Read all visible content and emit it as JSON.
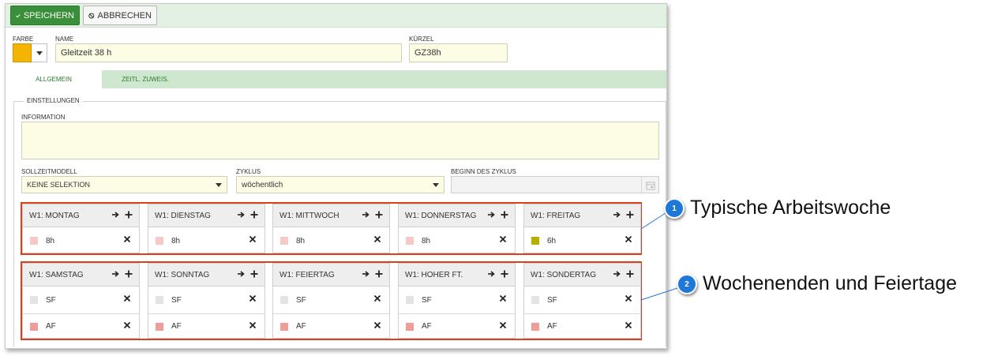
{
  "toolbar": {
    "save_label": "SPEICHERN",
    "cancel_label": "ABBRECHEN"
  },
  "form": {
    "color_label": "FARBE",
    "color_value": "#f5b400",
    "name_label": "NAME",
    "name_value": "Gleitzeit 38 h",
    "short_label": "KÜRZEL",
    "short_value": "GZ38h"
  },
  "tabs": [
    {
      "label": "ALLGEMEIN",
      "active": true
    },
    {
      "label": "ZEITL. ZUWEIS.",
      "active": false
    }
  ],
  "settings": {
    "legend": "EINSTELLUNGEN",
    "info_label": "INFORMATION",
    "info_value": "",
    "model_label": "SOLLZEITMODELL",
    "model_value": "KEINE SELEKTION",
    "cycle_label": "ZYKLUS",
    "cycle_value": "wöchentlich",
    "start_label": "BEGINN DES ZYKLUS",
    "start_value": ""
  },
  "week": [
    {
      "title": "W1: MONTAG",
      "entries": [
        {
          "label": "8h",
          "color": "#f6c9c9"
        }
      ]
    },
    {
      "title": "W1: DIENSTAG",
      "entries": [
        {
          "label": "8h",
          "color": "#f6c9c9"
        }
      ]
    },
    {
      "title": "W1: MITTWOCH",
      "entries": [
        {
          "label": "8h",
          "color": "#f6c9c9"
        }
      ]
    },
    {
      "title": "W1: DONNERSTAG",
      "entries": [
        {
          "label": "8h",
          "color": "#f6c9c9"
        }
      ]
    },
    {
      "title": "W1: FREITAG",
      "entries": [
        {
          "label": "6h",
          "color": "#b5b000"
        }
      ]
    }
  ],
  "special": [
    {
      "title": "W1: SAMSTAG",
      "entries": [
        {
          "label": "SF",
          "color": "#e3e3e3"
        },
        {
          "label": "AF",
          "color": "#f29b9b"
        }
      ]
    },
    {
      "title": "W1: SONNTAG",
      "entries": [
        {
          "label": "SF",
          "color": "#e3e3e3"
        },
        {
          "label": "AF",
          "color": "#f29b9b"
        }
      ]
    },
    {
      "title": "W1: FEIERTAG",
      "entries": [
        {
          "label": "SF",
          "color": "#e3e3e3"
        },
        {
          "label": "AF",
          "color": "#f29b9b"
        }
      ]
    },
    {
      "title": "W1: HOHER FT.",
      "entries": [
        {
          "label": "SF",
          "color": "#e3e3e3"
        },
        {
          "label": "AF",
          "color": "#f29b9b"
        }
      ]
    },
    {
      "title": "W1: SONDERTAG",
      "entries": [
        {
          "label": "SF",
          "color": "#e3e3e3"
        },
        {
          "label": "AF",
          "color": "#f29b9b"
        }
      ]
    }
  ],
  "callouts": [
    {
      "number": "1",
      "text": "Typische Arbeitswoche"
    },
    {
      "number": "2",
      "text": "Wochenenden und Feiertage"
    }
  ],
  "colors": {
    "accent_green": "#3a8f3a",
    "highlight_red": "#d9401c",
    "callout_blue": "#1e78d8"
  },
  "icons": {
    "save": "check-icon",
    "cancel": "ban-icon",
    "copy": "arrow-right-icon",
    "add": "plus-icon",
    "remove": "close-icon",
    "calendar": "calendar-icon"
  }
}
